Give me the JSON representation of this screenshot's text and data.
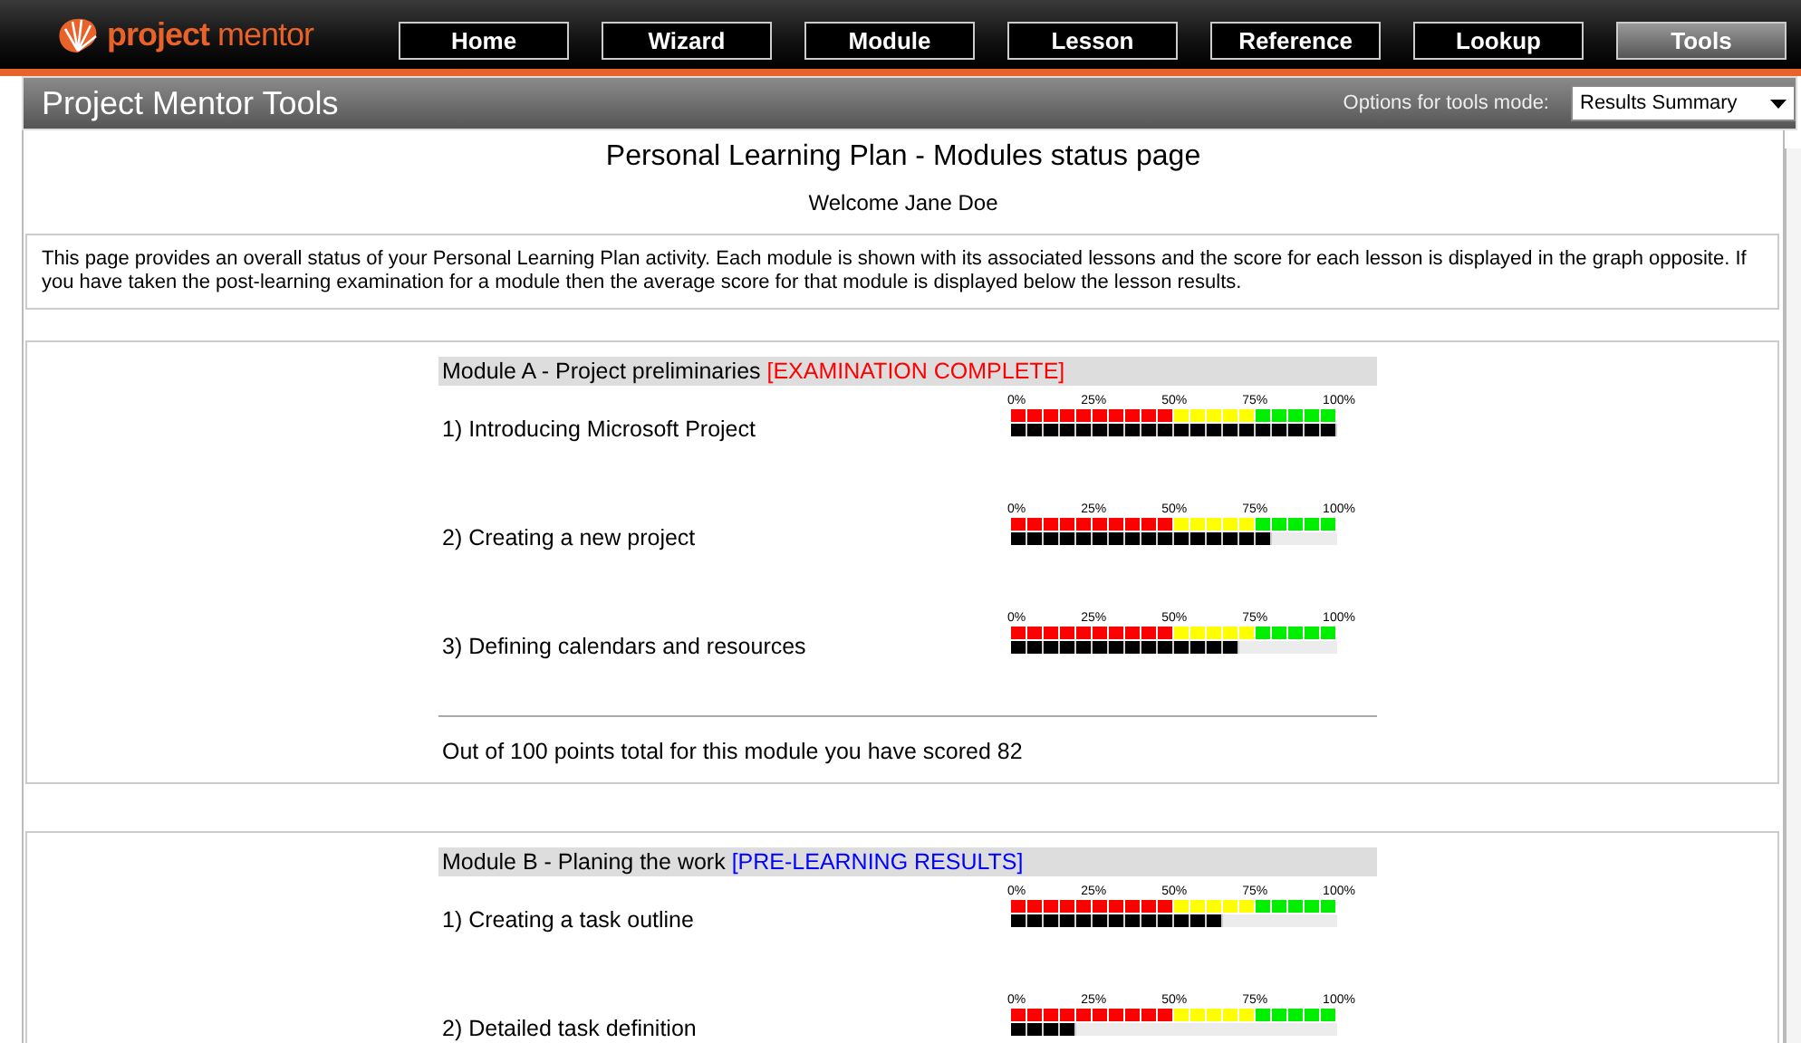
{
  "logo": {
    "text_a": "project",
    "text_b": "mentor"
  },
  "nav": [
    {
      "label": "Home",
      "selected": false
    },
    {
      "label": "Wizard",
      "selected": false
    },
    {
      "label": "Module",
      "selected": false
    },
    {
      "label": "Lesson",
      "selected": false
    },
    {
      "label": "Reference",
      "selected": false
    },
    {
      "label": "Lookup",
      "selected": false
    },
    {
      "label": "Tools",
      "selected": true
    }
  ],
  "title_bar": {
    "title": "Project Mentor Tools",
    "options_label": "Options for tools mode:",
    "mode_value": "Results Summary"
  },
  "page": {
    "heading": "Personal Learning Plan - Modules status page",
    "welcome": "Welcome Jane Doe",
    "intro": "This page provides an overall status of your Personal Learning Plan activity.  Each module is shown with its associated lessons and the score for each lesson is displayed in the graph opposite.  If you have taken the post-learning examination for a module then the average score for that module is displayed below the lesson results."
  },
  "modules": [
    {
      "title": "Module A - Project preliminaries",
      "status": "[EXAMINATION COMPLETE]",
      "color": "#ff0000",
      "lessons": [
        {
          "name": "1) Introducing Microsoft Project",
          "ticks": [
            "0%",
            "25%",
            "50%",
            "75%",
            "100%"
          ],
          "level": 1.0
        },
        {
          "name": "2) Creating a new project",
          "ticks": [
            "0%",
            "25%",
            "50%",
            "75%",
            "100%"
          ],
          "level": 0.8
        },
        {
          "name": "3) Defining calendars and resources",
          "ticks": [
            "0%",
            "25%",
            "50%",
            "75%",
            "100%"
          ],
          "level": 0.7
        }
      ],
      "summary": "Out of 100 points total for this module you have scored 82"
    },
    {
      "title": "Module B - Planing the work",
      "status": "[PRE-LEARNING RESULTS]",
      "color": "#0000ff",
      "lessons": [
        {
          "name": "1) Creating a task outline",
          "ticks": [
            "0%",
            "25%",
            "50%",
            "75%",
            "100%"
          ],
          "level": 0.65
        },
        {
          "name": "2) Detailed task definition",
          "ticks": [
            "0%",
            "25%",
            "50%",
            "75%",
            "100%"
          ],
          "level": 0.2
        }
      ]
    }
  ]
}
